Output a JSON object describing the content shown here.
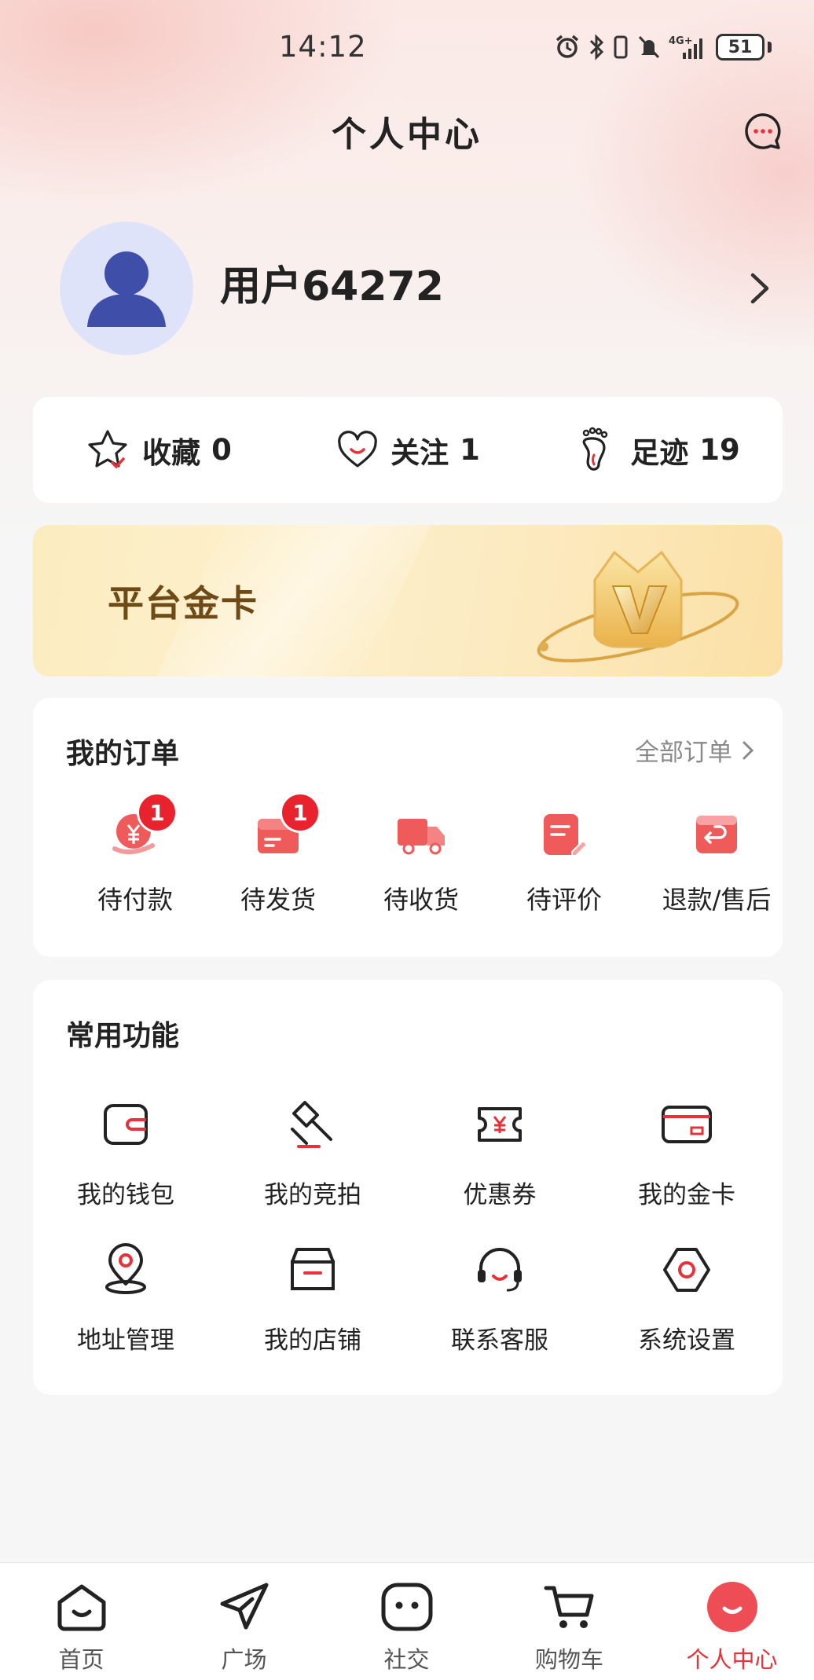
{
  "status_bar": {
    "time": "14:12",
    "battery": "51",
    "network": "4G+"
  },
  "header": {
    "title": "个人中心",
    "message_icon": "chat-bubble-icon"
  },
  "profile": {
    "username": "用户64272",
    "avatar_icon": "user-avatar-icon"
  },
  "stats": [
    {
      "label": "收藏",
      "count": "0",
      "icon": "star-icon"
    },
    {
      "label": "关注",
      "count": "1",
      "icon": "heart-icon"
    },
    {
      "label": "足迹",
      "count": "19",
      "icon": "footprint-icon"
    }
  ],
  "gold_card": {
    "title": "平台金卡",
    "icon": "crown-v-icon"
  },
  "orders": {
    "title": "我的订单",
    "all_link": "全部订单",
    "items": [
      {
        "label": "待付款",
        "badge": "1",
        "icon": "payment-icon"
      },
      {
        "label": "待发货",
        "badge": "1",
        "icon": "box-icon"
      },
      {
        "label": "待收货",
        "badge": "",
        "icon": "truck-icon"
      },
      {
        "label": "待评价",
        "badge": "",
        "icon": "review-icon"
      },
      {
        "label": "退款/售后",
        "badge": "",
        "icon": "refund-icon"
      }
    ]
  },
  "functions": {
    "title": "常用功能",
    "items": [
      {
        "label": "我的钱包",
        "icon": "wallet-icon"
      },
      {
        "label": "我的竞拍",
        "icon": "auction-hammer-icon"
      },
      {
        "label": "优惠券",
        "icon": "coupon-icon"
      },
      {
        "label": "我的金卡",
        "icon": "card-icon"
      },
      {
        "label": "地址管理",
        "icon": "location-pin-icon"
      },
      {
        "label": "我的店铺",
        "icon": "store-icon"
      },
      {
        "label": "联系客服",
        "icon": "headset-icon"
      },
      {
        "label": "系统设置",
        "icon": "settings-icon"
      }
    ]
  },
  "tabbar": {
    "active_index": 4,
    "items": [
      {
        "label": "首页",
        "icon": "home-icon"
      },
      {
        "label": "广场",
        "icon": "paper-plane-icon"
      },
      {
        "label": "社交",
        "icon": "social-face-icon"
      },
      {
        "label": "购物车",
        "icon": "cart-icon"
      },
      {
        "label": "个人中心",
        "icon": "profile-smile-icon"
      }
    ]
  },
  "colors": {
    "accent": "#e8323a",
    "gold_text": "#6e4a16",
    "badge": "#e8232d",
    "background": "#f6f6f6"
  }
}
